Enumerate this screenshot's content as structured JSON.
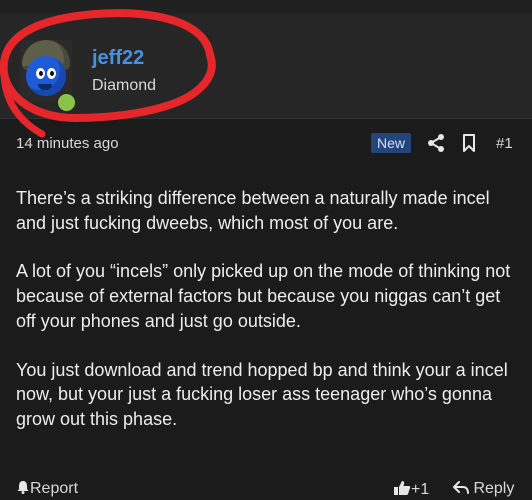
{
  "post": {
    "author": {
      "username": "jeff22",
      "rank": "Diamond",
      "status_color": "#8bc34a",
      "avatar_icon": "blue-smiley-helmet-avatar"
    },
    "meta": {
      "timestamp": "14 minutes ago",
      "badge": "New",
      "post_number": "#1",
      "share_icon": "share-icon",
      "bookmark_icon": "bookmark-icon"
    },
    "body": {
      "paragraphs": [
        "There’s a striking difference between a naturally made incel and just fucking dweebs, which most of you are.",
        "A lot of you “incels” only picked up on the mode of thinking not because of external factors but because you niggas can’t get off your phones and just go outside.",
        "You just download and trend hopped bp and think your a incel now, but your just a fucking loser ass teenager who’s gonna grow out this phase."
      ]
    },
    "footer": {
      "report_label": "Report",
      "like_count": "+1",
      "reply_label": "Reply"
    }
  },
  "colors": {
    "background": "#1b1b1b",
    "header_background": "#262626",
    "username": "#4a90e2",
    "badge_background": "#23457a",
    "annotation_red": "#e5262b"
  }
}
